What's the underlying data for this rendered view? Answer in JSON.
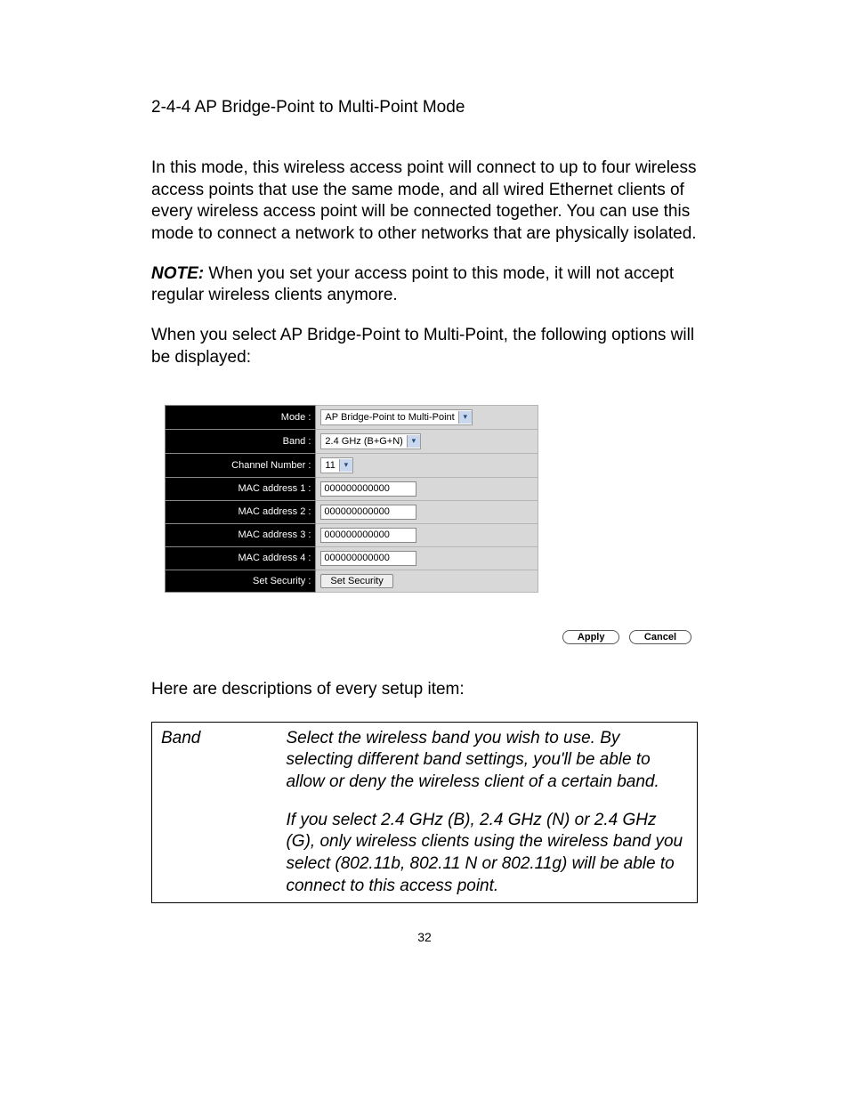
{
  "section_title": "2-4-4 AP Bridge-Point to Multi-Point Mode",
  "para1": "In this mode, this wireless access point will connect to up to four wireless access points that use the same mode, and all wired Ethernet clients of every wireless access point will be connected together. You can use this mode to connect a network to other networks that are physically isolated.",
  "note_label": "NOTE:",
  "note_text": " When you set your access point to this mode, it will not accept regular wireless clients anymore.",
  "para3": "When you select AP Bridge-Point to Multi-Point, the following options will be displayed:",
  "config": {
    "rows": {
      "mode": {
        "label": "Mode :",
        "value": "AP Bridge-Point to Multi-Point"
      },
      "band": {
        "label": "Band :",
        "value": "2.4 GHz (B+G+N)"
      },
      "channel": {
        "label": "Channel Number :",
        "value": "11"
      },
      "mac1": {
        "label": "MAC address 1 :",
        "value": "000000000000"
      },
      "mac2": {
        "label": "MAC address 2 :",
        "value": "000000000000"
      },
      "mac3": {
        "label": "MAC address 3 :",
        "value": "000000000000"
      },
      "mac4": {
        "label": "MAC address 4 :",
        "value": "000000000000"
      },
      "security": {
        "label": "Set Security :",
        "button": "Set Security"
      }
    },
    "apply_label": "Apply",
    "cancel_label": "Cancel"
  },
  "desc_intro": "Here are descriptions of every setup item:",
  "desc_table": {
    "term": "Band",
    "def_p1": "Select the wireless band you wish to use. By selecting different band settings, you'll be able to allow or deny the wireless client of a certain band.",
    "def_p2": "If you select 2.4 GHz (B), 2.4 GHz (N) or 2.4 GHz (G), only wireless clients using the wireless band you select (802.11b, 802.11 N or 802.11g) will be able to connect to this access point."
  },
  "page_number": "32"
}
